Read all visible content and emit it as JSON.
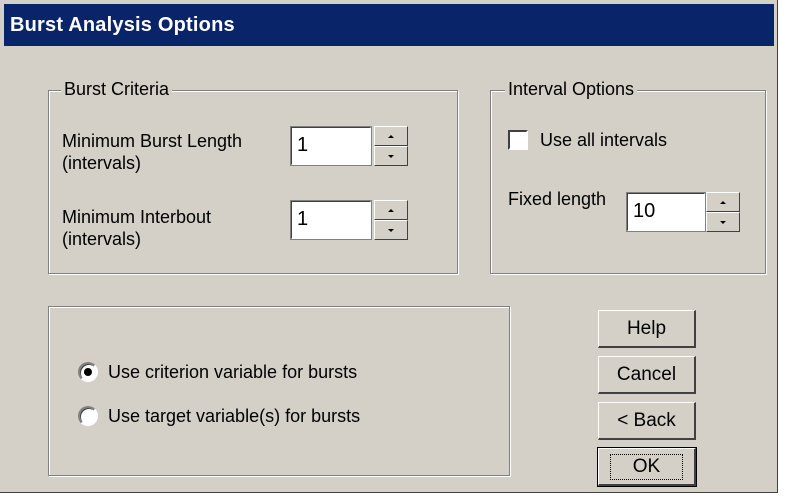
{
  "window": {
    "title": "Burst Analysis Options"
  },
  "burst_criteria": {
    "legend": "Burst Criteria",
    "min_burst_length": {
      "label_line1": "Minimum Burst Length",
      "label_line2": "(intervals)",
      "value": "1"
    },
    "min_interbout": {
      "label_line1": "Minimum Interbout",
      "label_line2": "(intervals)",
      "value": "1"
    }
  },
  "interval_options": {
    "legend": "Interval Options",
    "use_all_intervals": {
      "label": "Use all intervals",
      "checked": false
    },
    "fixed_length": {
      "label": "Fixed length",
      "value": "10"
    }
  },
  "burst_variable": {
    "options": [
      {
        "label": "Use criterion variable for bursts",
        "selected": true
      },
      {
        "label": "Use target variable(s) for bursts",
        "selected": false
      }
    ]
  },
  "buttons": {
    "help": "Help",
    "cancel": "Cancel",
    "back": "< Back",
    "ok": "OK"
  },
  "colors": {
    "title_bar": "#0a246a",
    "face": "#d4d0c8"
  }
}
